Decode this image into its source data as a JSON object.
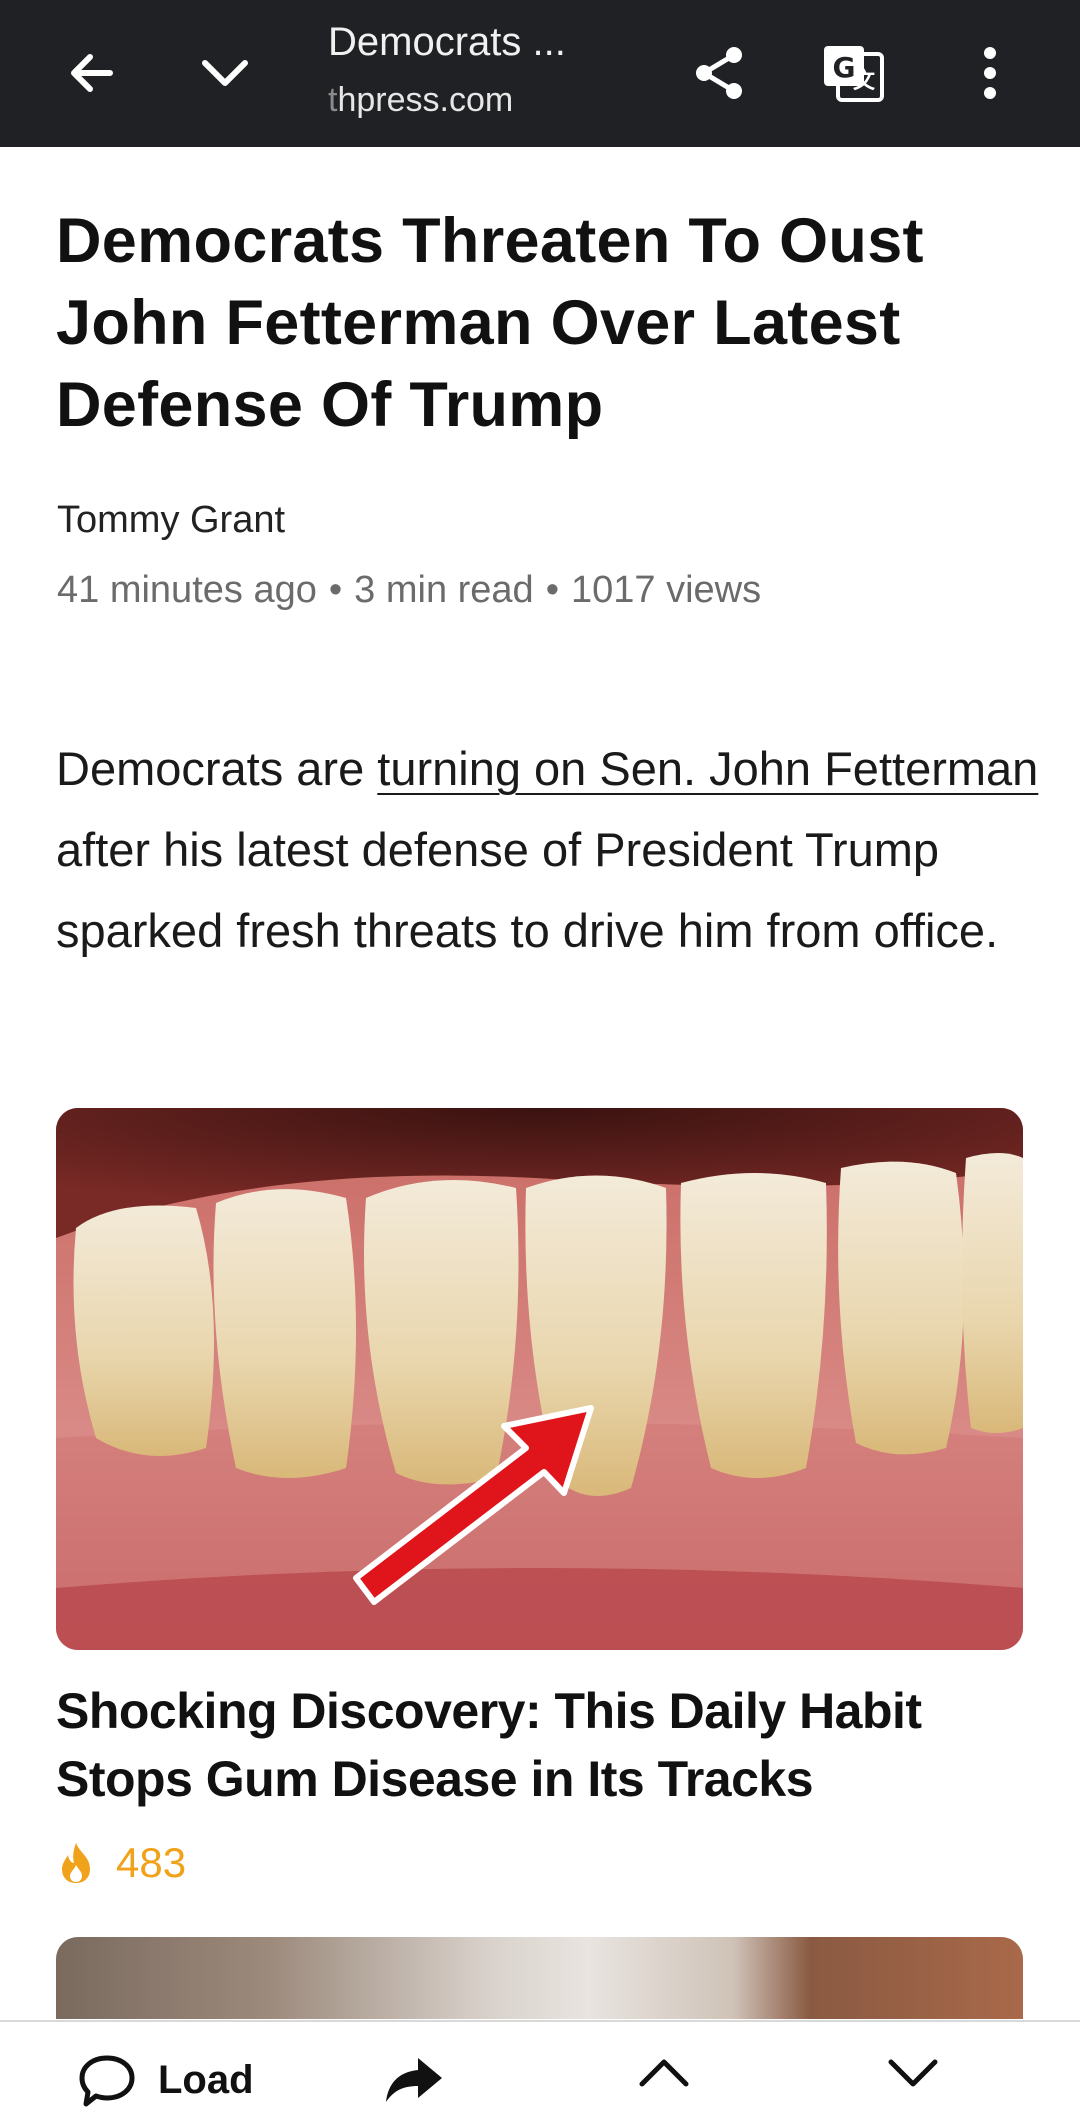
{
  "browser": {
    "page_title": "Democrats ...",
    "url_faded": "t",
    "url": "hpress.com",
    "icons": [
      "back-arrow-icon",
      "chevron-down-icon",
      "share-icon",
      "translate-icon",
      "more-vert-icon"
    ],
    "colors": {
      "bar_background": "#202124",
      "bar_text": "#ffffff"
    }
  },
  "article": {
    "headline": "Democrats Threaten To Oust John Fetterman Over Latest Defense Of Trump",
    "author": "Tommy Grant",
    "meta": {
      "time_ago": "41 minutes ago",
      "read_time": "3 min read",
      "views": "1017 views",
      "separator": "•"
    },
    "lead": {
      "before_link": "Democrats are ",
      "link_text": "turning on Sen. John Fetterman",
      "after_link": " after his latest defense of President Trump sparked fresh threats to drive him from office."
    }
  },
  "ad": {
    "title": "Shocking Discovery: This Daily Habit Stops Gum Disease in Its Tracks",
    "reactions": "483",
    "reaction_icon": "fire-icon",
    "colors": {
      "reaction": "#f0a21a"
    }
  },
  "bottom_bar": {
    "load_label": "Load",
    "icons": [
      "comment-icon",
      "forward-share-icon",
      "chevron-up-icon",
      "chevron-down-icon"
    ]
  }
}
